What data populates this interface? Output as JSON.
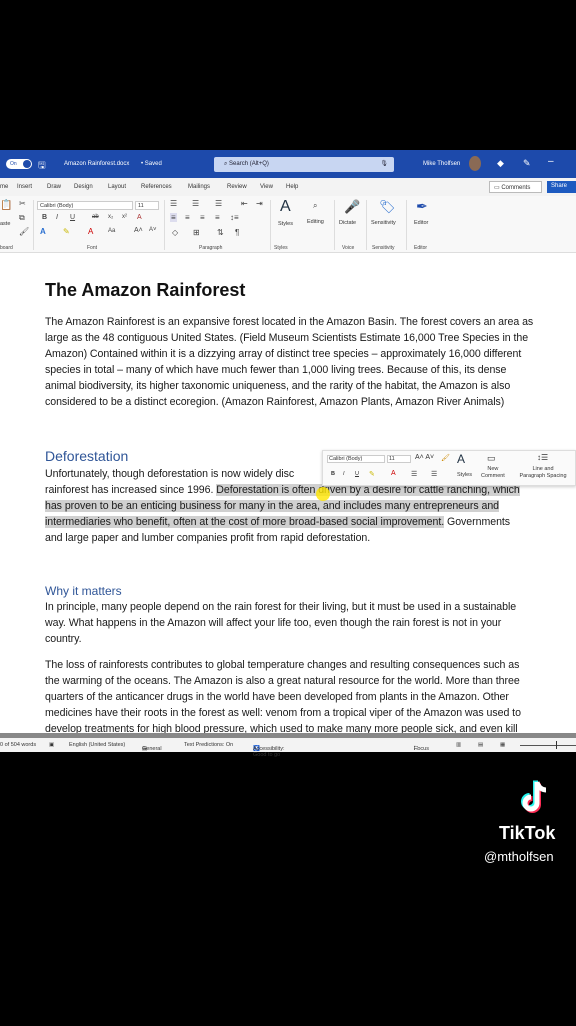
{
  "titlebar": {
    "autosave": "On",
    "filename": "Amazon Rainforest.docx",
    "saved": "• Saved",
    "search_placeholder": "Search (Alt+Q)",
    "user": "Mike Tholfsen"
  },
  "tabs": [
    "me",
    "Insert",
    "Draw",
    "Design",
    "Layout",
    "References",
    "Mailings",
    "Review",
    "View",
    "Help"
  ],
  "comments_label": "Comments",
  "share_label": "Share",
  "ribbon": {
    "font": "Calibri (Body)",
    "size": "11",
    "groups": [
      "board",
      "Font",
      "Paragraph",
      "Styles",
      "Voice",
      "Sensitivity",
      "Editor"
    ],
    "buttons": [
      "aste",
      "Styles",
      "Editing",
      "Dictate",
      "Sensitivity",
      "Editor"
    ]
  },
  "doc": {
    "title": "The Amazon Rainforest",
    "p1": [
      "The Amazon Rainforest is an expansive forest located in the Amazon Basin.  The forest covers an area as",
      "large as the 48 contiguous United States. (Field Museum Scientists Estimate 16,000 Tree Species in the",
      "Amazon)  Contained within it is a dizzying array of distinct tree species – approximately 16,000 different",
      "species in total – many of which have much fewer than 1,000 living trees.  Because of this, its dense",
      "animal biodiversity, its higher taxonomic uniqueness, and the rarity of the habitat, the Amazon is also",
      "considered to be a distinct ecoregion. (Amazon Rainforest, Amazon Plants, Amazon River Animals)"
    ],
    "h_deforestation": "Deforestation",
    "p2": [
      [
        {
          "t": "Unfortunately, though deforestation is now widely disc",
          "s": false
        }
      ],
      [
        {
          "t": "rainforest has increased since 1996. ",
          "s": false
        },
        {
          "t": "Deforestation is often driven by a desire for cattle ranching, which",
          "s": true
        }
      ],
      [
        {
          "t": "has proven to be an enticing business for many in the area, and includes many entrepreneurs and",
          "s": true
        }
      ],
      [
        {
          "t": "intermediaries who benefit, often at the cost of more broad-based social improvement.",
          "s": true
        },
        {
          "t": " Governments",
          "s": false
        }
      ],
      [
        {
          "t": "and large paper and lumber companies profit from rapid deforestation.",
          "s": false
        }
      ]
    ],
    "h_why": "Why it matters",
    "p3": [
      "In principle, many people depend on the rain forest for their living, but it must be used in a sustainable",
      "way. What happens in the Amazon will affect your life too, even though the rain forest is not in your",
      "country."
    ],
    "p4": [
      "The loss of rainforests contributes to global temperature changes and resulting consequences such as",
      "the warming of the oceans. The Amazon is also a great natural resource for the world. More than three",
      "quarters of the anticancer drugs in the world have been developed from plants in the Amazon. Other",
      "medicines have their roots in the forest as well: venom from a tropical viper of the Amazon was used to",
      "develop treatments for high blood pressure, which used to make many more people sick, and even kill"
    ]
  },
  "mini_toolbar": {
    "font": "Calibri (Body)",
    "size": "11",
    "styles": "Styles",
    "new_comment": [
      "New",
      "Comment"
    ],
    "spacing": [
      "Line and",
      "Paragraph Spacing"
    ]
  },
  "status": {
    "words": "0 of 504 words",
    "language": "English (United States)",
    "general": "General",
    "predictions": "Text Predictions: On",
    "accessibility": "Accessibility: Good to go",
    "focus": "Focus"
  },
  "tiktok": {
    "brand": "TikTok",
    "handle": "@mtholfsen"
  }
}
